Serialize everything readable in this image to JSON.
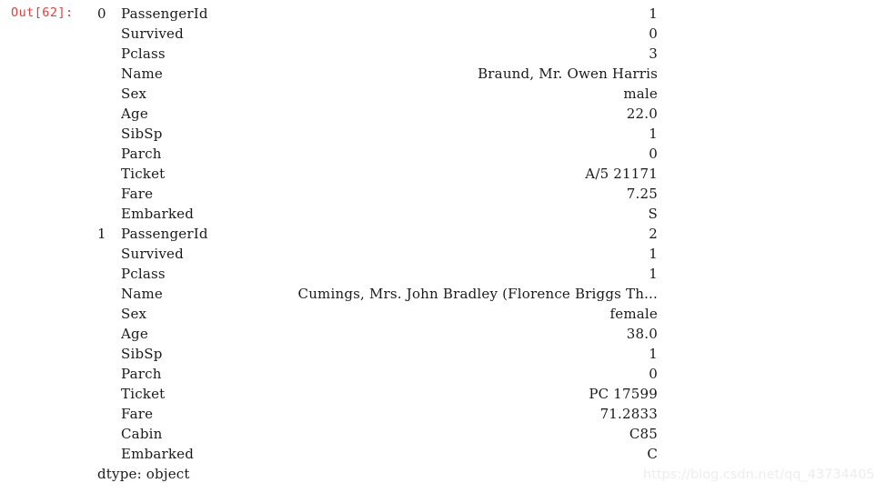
{
  "cell": {
    "prompt_label": "Out[62]:",
    "prompt_color": "#d64541",
    "background_color": "#ffffff",
    "text_color": "#1a1a1a",
    "dtype_line": "dtype: object"
  },
  "series": {
    "rows": [
      {
        "index": "0",
        "field": "PassengerId",
        "value": "1"
      },
      {
        "index": "",
        "field": "Survived",
        "value": "0"
      },
      {
        "index": "",
        "field": "Pclass",
        "value": "3"
      },
      {
        "index": "",
        "field": "Name",
        "value": "Braund, Mr. Owen Harris"
      },
      {
        "index": "",
        "field": "Sex",
        "value": "male"
      },
      {
        "index": "",
        "field": "Age",
        "value": "22.0"
      },
      {
        "index": "",
        "field": "SibSp",
        "value": "1"
      },
      {
        "index": "",
        "field": "Parch",
        "value": "0"
      },
      {
        "index": "",
        "field": "Ticket",
        "value": "A/5 21171"
      },
      {
        "index": "",
        "field": "Fare",
        "value": "7.25"
      },
      {
        "index": "",
        "field": "Embarked",
        "value": "S"
      },
      {
        "index": "1",
        "field": "PassengerId",
        "value": "2"
      },
      {
        "index": "",
        "field": "Survived",
        "value": "1"
      },
      {
        "index": "",
        "field": "Pclass",
        "value": "1"
      },
      {
        "index": "",
        "field": "Name",
        "value": "Cumings, Mrs. John Bradley (Florence Briggs Th..."
      },
      {
        "index": "",
        "field": "Sex",
        "value": "female"
      },
      {
        "index": "",
        "field": "Age",
        "value": "38.0"
      },
      {
        "index": "",
        "field": "SibSp",
        "value": "1"
      },
      {
        "index": "",
        "field": "Parch",
        "value": "0"
      },
      {
        "index": "",
        "field": "Ticket",
        "value": "PC 17599"
      },
      {
        "index": "",
        "field": "Fare",
        "value": "71.2833"
      },
      {
        "index": "",
        "field": "Cabin",
        "value": "C85"
      },
      {
        "index": "",
        "field": "Embarked",
        "value": "C"
      }
    ]
  },
  "watermark": {
    "text": "https://blog.csdn.net/qq_43734405",
    "color": "#ededed"
  }
}
